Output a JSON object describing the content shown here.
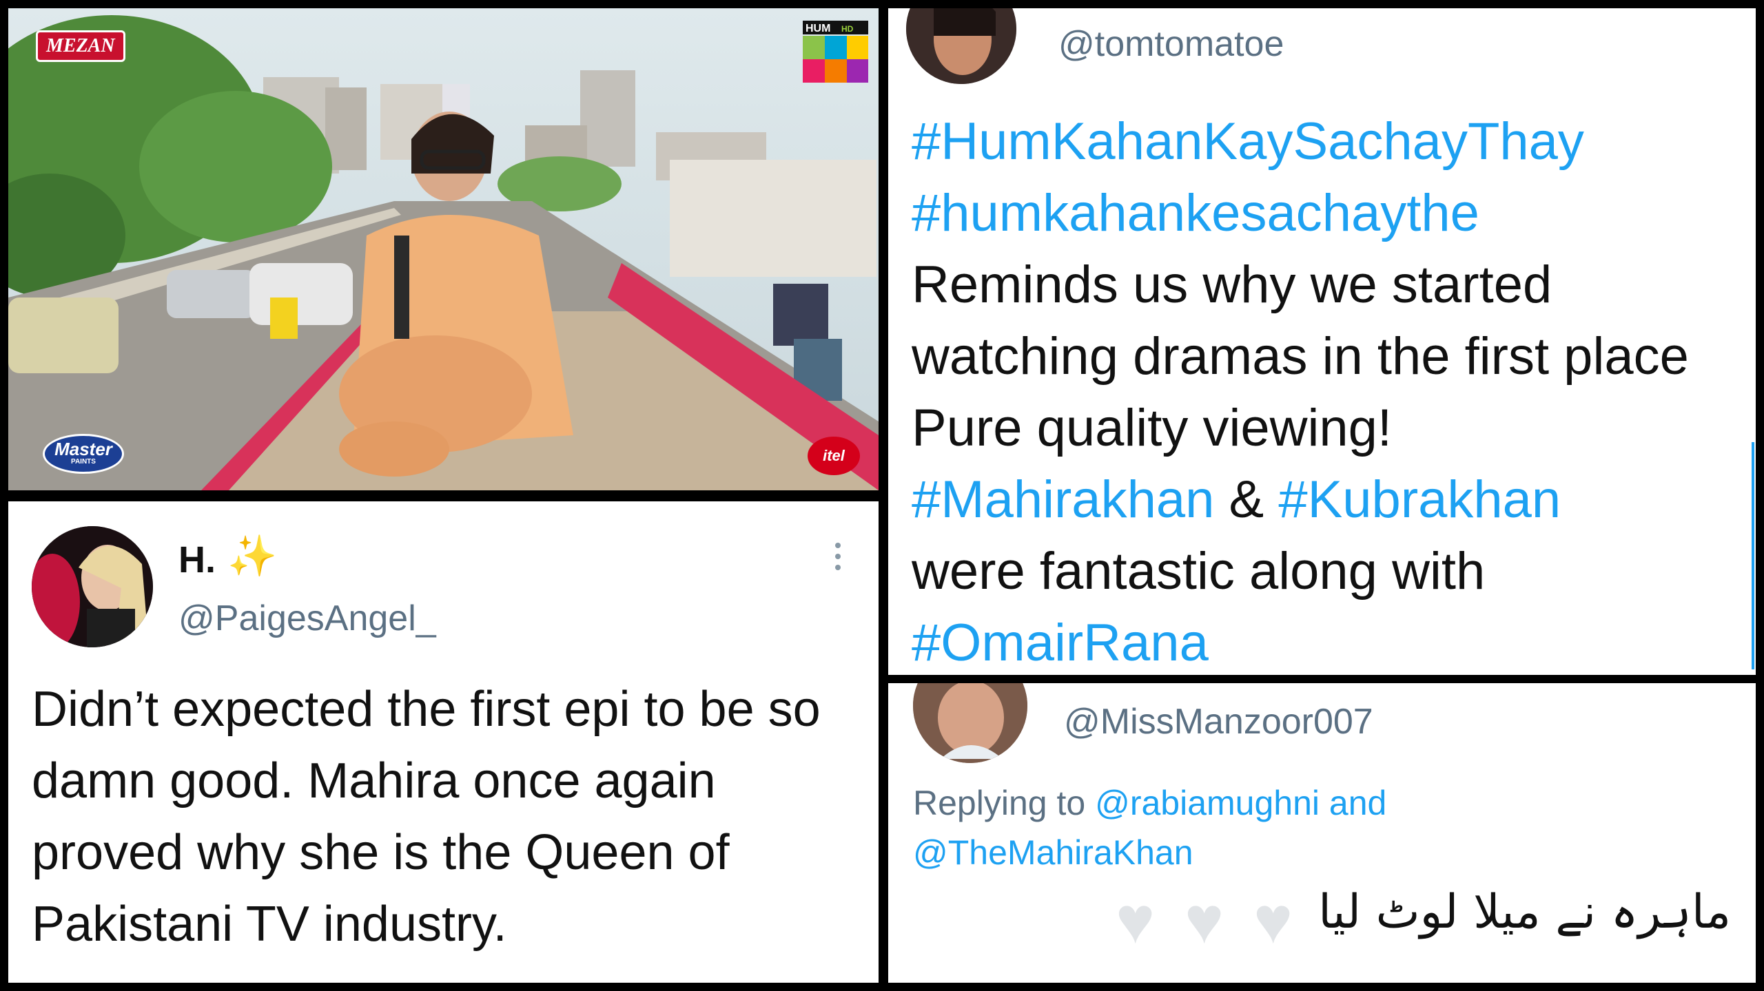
{
  "video": {
    "channel_logo": "HUM",
    "channel_badge": "HD",
    "sponsor_top_left": "MEZAN",
    "sponsor_bottom_left": "Master",
    "sponsor_bottom_left_sub": "PAINTS",
    "sponsor_bottom_right": "itel"
  },
  "tweet1": {
    "name": "H.",
    "name_emoji": "sparkles-icon",
    "handle": "@PaigesAngel_",
    "text": "Didn’t expected the first epi to be so damn good. Mahira once again proved why she is the Queen of Pakistani TV industry."
  },
  "tweet2": {
    "handle": "@tomtomatoe",
    "hashtag1": "#HumKahanKaySachayThay",
    "hashtag2": "#humkahankesachaythe",
    "text1": "Reminds us why we started watching dramas in the first place Pure quality viewing!",
    "hashtag3": "#Mahirakhan",
    "amp": "&",
    "hashtag4": "#Kubrakhan",
    "text2": "were fantastic along with",
    "hashtag5": "#OmairRana"
  },
  "tweet3": {
    "handle": "@MissManzoor007",
    "replying_prefix": "Replying to",
    "reply_user1": "@rabiamughni",
    "reply_and": "and",
    "reply_user2": "@TheMahiraKhan",
    "urdu_text": "ماہرہ نے میلا لوٹ لیا",
    "hearts": [
      "white-heart-icon",
      "white-heart-icon",
      "white-heart-icon"
    ]
  },
  "colors": {
    "link": "#1da1f2",
    "secondary_text": "#5b7083",
    "primary_text": "#111111",
    "heart": "#e1e4e7"
  }
}
